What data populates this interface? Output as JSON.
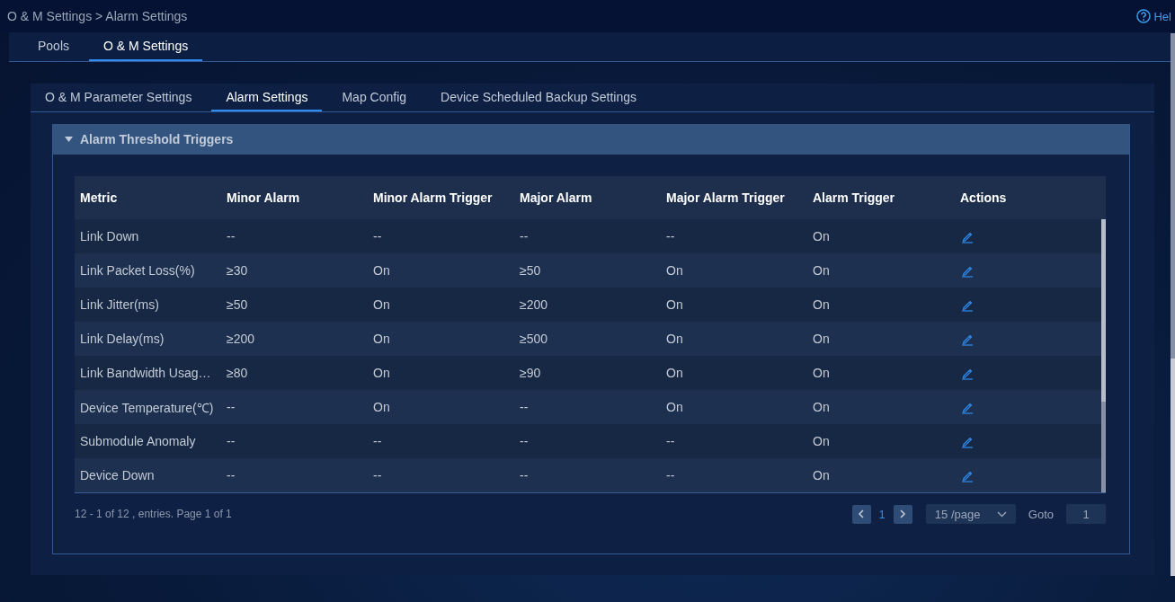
{
  "breadcrumb": "O & M Settings > Alarm Settings",
  "help": "Hel",
  "tabs": [
    {
      "label": "Pools",
      "selected": false
    },
    {
      "label": "O & M Settings",
      "selected": true
    }
  ],
  "subtabs": [
    {
      "label": "O & M Parameter Settings",
      "selected": false
    },
    {
      "label": "Alarm Settings",
      "selected": true
    },
    {
      "label": "Map Config",
      "selected": false
    },
    {
      "label": "Device Scheduled Backup Settings",
      "selected": false
    }
  ],
  "section": {
    "title": "Alarm Threshold Triggers",
    "expanded": true
  },
  "table": {
    "columns": [
      "Metric",
      "Minor Alarm",
      "Minor Alarm Trigger",
      "Major Alarm",
      "Major Alarm Trigger",
      "Alarm Trigger",
      "Actions"
    ],
    "rows": [
      {
        "cells": [
          "Link Down",
          "--",
          "--",
          "--",
          "--",
          "On"
        ]
      },
      {
        "cells": [
          "Link Packet Loss(%)",
          "≥30",
          "On",
          "≥50",
          "On",
          "On"
        ]
      },
      {
        "cells": [
          "Link Jitter(ms)",
          "≥50",
          "On",
          "≥200",
          "On",
          "On"
        ]
      },
      {
        "cells": [
          "Link Delay(ms)",
          "≥200",
          "On",
          "≥500",
          "On",
          "On"
        ]
      },
      {
        "cells": [
          "Link Bandwidth Usag…",
          "≥80",
          "On",
          "≥90",
          "On",
          "On"
        ]
      },
      {
        "cells": [
          "Device Temperature(℃)",
          "--",
          "On",
          "--",
          "On",
          "On"
        ]
      },
      {
        "cells": [
          "Submodule Anomaly",
          "--",
          "--",
          "--",
          "--",
          "On"
        ]
      },
      {
        "cells": [
          "Device Down",
          "--",
          "--",
          "--",
          "--",
          "On"
        ]
      }
    ]
  },
  "pagination": {
    "summary": "12 - 1 of 12 , entries. Page 1 of 1",
    "pages": [
      {
        "label": "1",
        "selected": true
      }
    ],
    "page_size": "15 /page",
    "goto_label": "Goto",
    "goto_value": "1"
  }
}
